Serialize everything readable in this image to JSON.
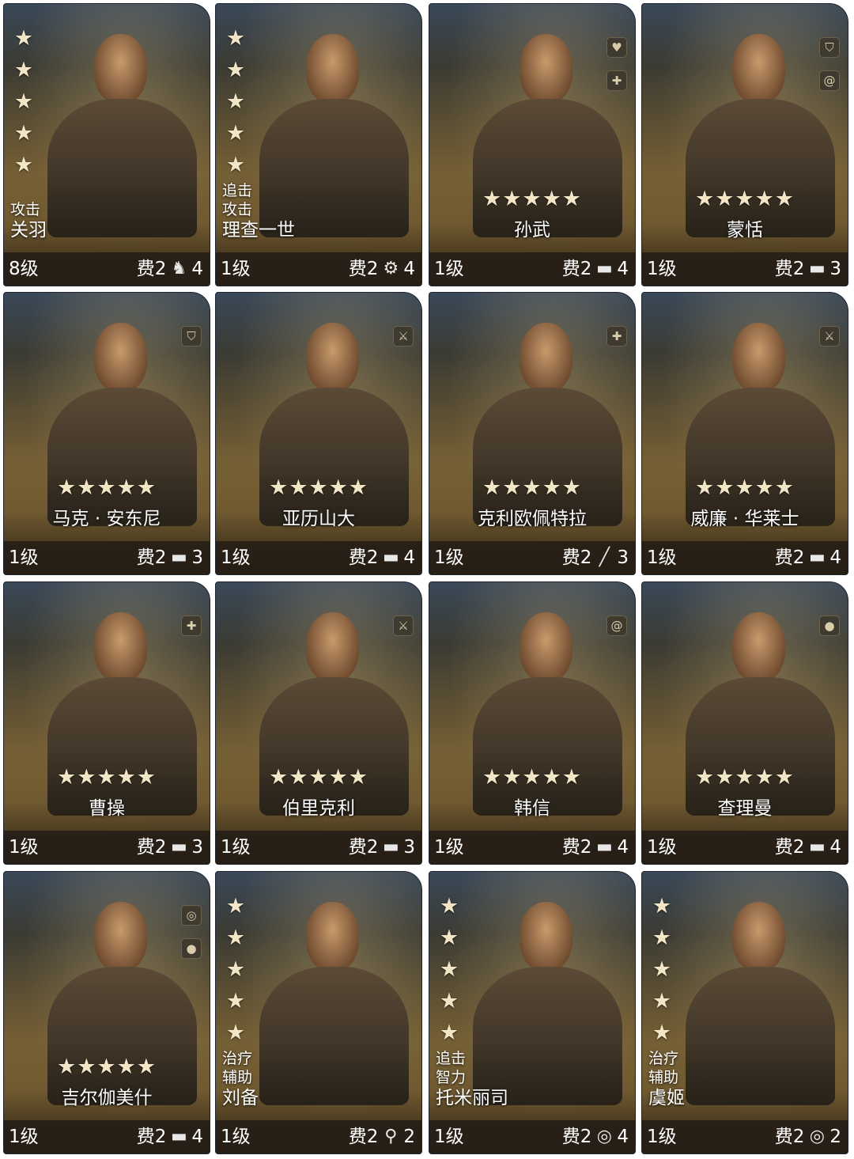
{
  "cost_prefix": "费",
  "cards": [
    {
      "name": "关羽",
      "roles": [
        "攻击"
      ],
      "level": "8级",
      "cost": "2",
      "unit_icon": "horse-icon",
      "unit_count": "4",
      "stars": 5,
      "star_layout": "column",
      "badges": []
    },
    {
      "name": "理查一世",
      "roles": [
        "追击",
        "攻击"
      ],
      "level": "1级",
      "cost": "2",
      "unit_icon": "chariot-icon",
      "unit_count": "4",
      "stars": 5,
      "star_layout": "column",
      "badges": []
    },
    {
      "name": "孙武",
      "roles": [],
      "level": "1级",
      "cost": "2",
      "unit_icon": "tank-icon",
      "unit_count": "4",
      "stars": 5,
      "star_layout": "row",
      "badges": [
        "heart-icon",
        "medic-cross-icon"
      ]
    },
    {
      "name": "蒙恬",
      "roles": [],
      "level": "1级",
      "cost": "2",
      "unit_icon": "tank-icon",
      "unit_count": "3",
      "stars": 5,
      "star_layout": "row",
      "badges": [
        "shield-icon",
        "spiral-icon"
      ]
    },
    {
      "name": "马克 · 安东尼",
      "roles": [],
      "level": "1级",
      "cost": "2",
      "unit_icon": "tank-icon",
      "unit_count": "3",
      "stars": 5,
      "star_layout": "row",
      "badges": [
        "shield-icon"
      ]
    },
    {
      "name": "亚历山大",
      "roles": [],
      "level": "1级",
      "cost": "2",
      "unit_icon": "tank-icon",
      "unit_count": "4",
      "stars": 5,
      "star_layout": "row",
      "badges": [
        "sword-icon"
      ]
    },
    {
      "name": "克利欧佩特拉",
      "roles": [],
      "level": "1级",
      "cost": "2",
      "unit_icon": "rifle-icon",
      "unit_count": "3",
      "stars": 5,
      "star_layout": "row",
      "badges": [
        "medic-cross-icon"
      ]
    },
    {
      "name": "威廉 · 华莱士",
      "roles": [],
      "level": "1级",
      "cost": "2",
      "unit_icon": "tank-icon",
      "unit_count": "4",
      "stars": 5,
      "star_layout": "row",
      "badges": [
        "sword-icon"
      ]
    },
    {
      "name": "曹操",
      "roles": [],
      "level": "1级",
      "cost": "2",
      "unit_icon": "tank-icon",
      "unit_count": "3",
      "stars": 5,
      "star_layout": "row",
      "badges": [
        "medic-cross-icon"
      ]
    },
    {
      "name": "伯里克利",
      "roles": [],
      "level": "1级",
      "cost": "2",
      "unit_icon": "tank-icon",
      "unit_count": "3",
      "stars": 5,
      "star_layout": "row",
      "badges": [
        "sword-icon"
      ]
    },
    {
      "name": "韩信",
      "roles": [],
      "level": "1级",
      "cost": "2",
      "unit_icon": "tank-icon",
      "unit_count": "4",
      "stars": 5,
      "star_layout": "row",
      "badges": [
        "spiral-icon"
      ]
    },
    {
      "name": "查理曼",
      "roles": [],
      "level": "1级",
      "cost": "2",
      "unit_icon": "tank-icon",
      "unit_count": "4",
      "stars": 5,
      "star_layout": "row",
      "badges": [
        "brain-icon"
      ]
    },
    {
      "name": "吉尔伽美什",
      "roles": [],
      "level": "1级",
      "cost": "2",
      "unit_icon": "tank-icon",
      "unit_count": "4",
      "stars": 5,
      "star_layout": "row",
      "badges": [
        "target-icon",
        "brain-icon"
      ]
    },
    {
      "name": "刘备",
      "roles": [
        "治疗",
        "辅助"
      ],
      "level": "1级",
      "cost": "2",
      "unit_icon": "torch-icon",
      "unit_count": "2",
      "stars": 5,
      "star_layout": "column",
      "badges": []
    },
    {
      "name": "托米丽司",
      "roles": [
        "追击",
        "智力"
      ],
      "level": "1级",
      "cost": "2",
      "unit_icon": "target-icon",
      "unit_count": "4",
      "stars": 5,
      "star_layout": "column",
      "badges": []
    },
    {
      "name": "虞姬",
      "roles": [
        "治疗",
        "辅助"
      ],
      "level": "1级",
      "cost": "2",
      "unit_icon": "target-icon",
      "unit_count": "2",
      "stars": 5,
      "star_layout": "column",
      "badges": []
    }
  ]
}
